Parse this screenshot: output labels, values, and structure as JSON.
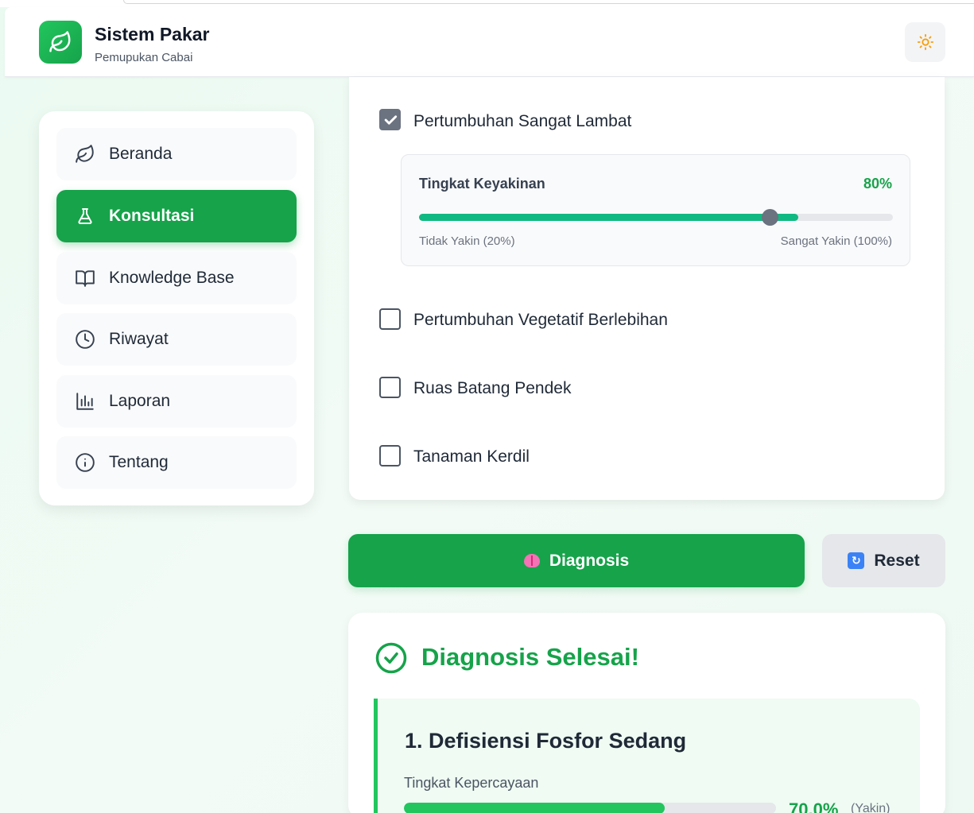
{
  "app": {
    "title": "Sistem Pakar",
    "subtitle": "Pemupukan Cabai"
  },
  "sidebar": {
    "items": [
      {
        "label": "Beranda",
        "icon": "leaf-icon",
        "active": false
      },
      {
        "label": "Konsultasi",
        "icon": "flask-icon",
        "active": true
      },
      {
        "label": "Knowledge Base",
        "icon": "book-icon",
        "active": false
      },
      {
        "label": "Riwayat",
        "icon": "clock-icon",
        "active": false
      },
      {
        "label": "Laporan",
        "icon": "bar-chart-icon",
        "active": false
      },
      {
        "label": "Tentang",
        "icon": "info-icon",
        "active": false
      }
    ]
  },
  "symptoms": [
    {
      "label": "Pertumbuhan Sangat Lambat",
      "checked": true
    },
    {
      "label": "Pertumbuhan Vegetatif Berlebihan",
      "checked": false
    },
    {
      "label": "Ruas Batang Pendek",
      "checked": false
    },
    {
      "label": "Tanaman Kerdil",
      "checked": false
    }
  ],
  "confidence": {
    "title": "Tingkat Keyakinan",
    "value": "80%",
    "min_label": "Tidak Yakin (20%)",
    "max_label": "Sangat Yakin (100%)",
    "fraction": 0.8
  },
  "actions": {
    "diagnose_label": "Diagnosis",
    "reset_label": "Reset"
  },
  "result": {
    "title": "Diagnosis Selesai!",
    "items": [
      {
        "title": "1. Defisiensi Fosfor Sedang",
        "label": "Tingkat Kepercayaan",
        "percent": "70.0%",
        "fraction": 0.7,
        "tag": "(Yakin)"
      }
    ]
  },
  "colors": {
    "primary": "#16a34a",
    "accent": "#10b981",
    "background": "#eafaf1"
  }
}
